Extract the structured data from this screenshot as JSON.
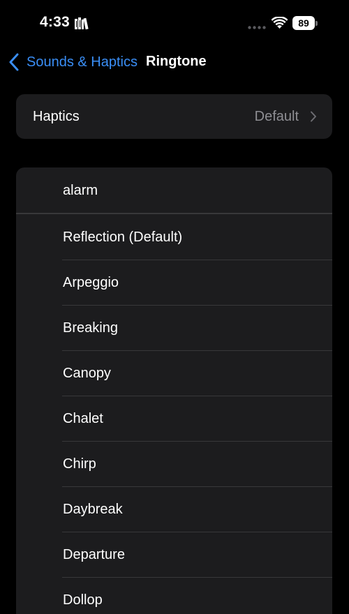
{
  "status_bar": {
    "time": "4:33",
    "battery": "89"
  },
  "nav": {
    "back_label": "Sounds & Haptics",
    "title": "Ringtone"
  },
  "haptics": {
    "label": "Haptics",
    "value": "Default"
  },
  "alarm_row": {
    "label": "alarm"
  },
  "tones": [
    {
      "label": "Reflection (Default)"
    },
    {
      "label": "Arpeggio"
    },
    {
      "label": "Breaking"
    },
    {
      "label": "Canopy"
    },
    {
      "label": "Chalet"
    },
    {
      "label": "Chirp"
    },
    {
      "label": "Daybreak"
    },
    {
      "label": "Departure"
    },
    {
      "label": "Dollop"
    }
  ],
  "colors": {
    "accent": "#3a8ef6",
    "background": "#000000",
    "card": "#1c1c1e",
    "secondary_text": "#8e8e93",
    "separator": "#38383a"
  },
  "icons": {
    "status": [
      "book-icon",
      "signal-dots-icon",
      "wifi-icon",
      "battery-icon"
    ],
    "nav": "chevron-left-icon",
    "haptics": "chevron-right-icon"
  }
}
